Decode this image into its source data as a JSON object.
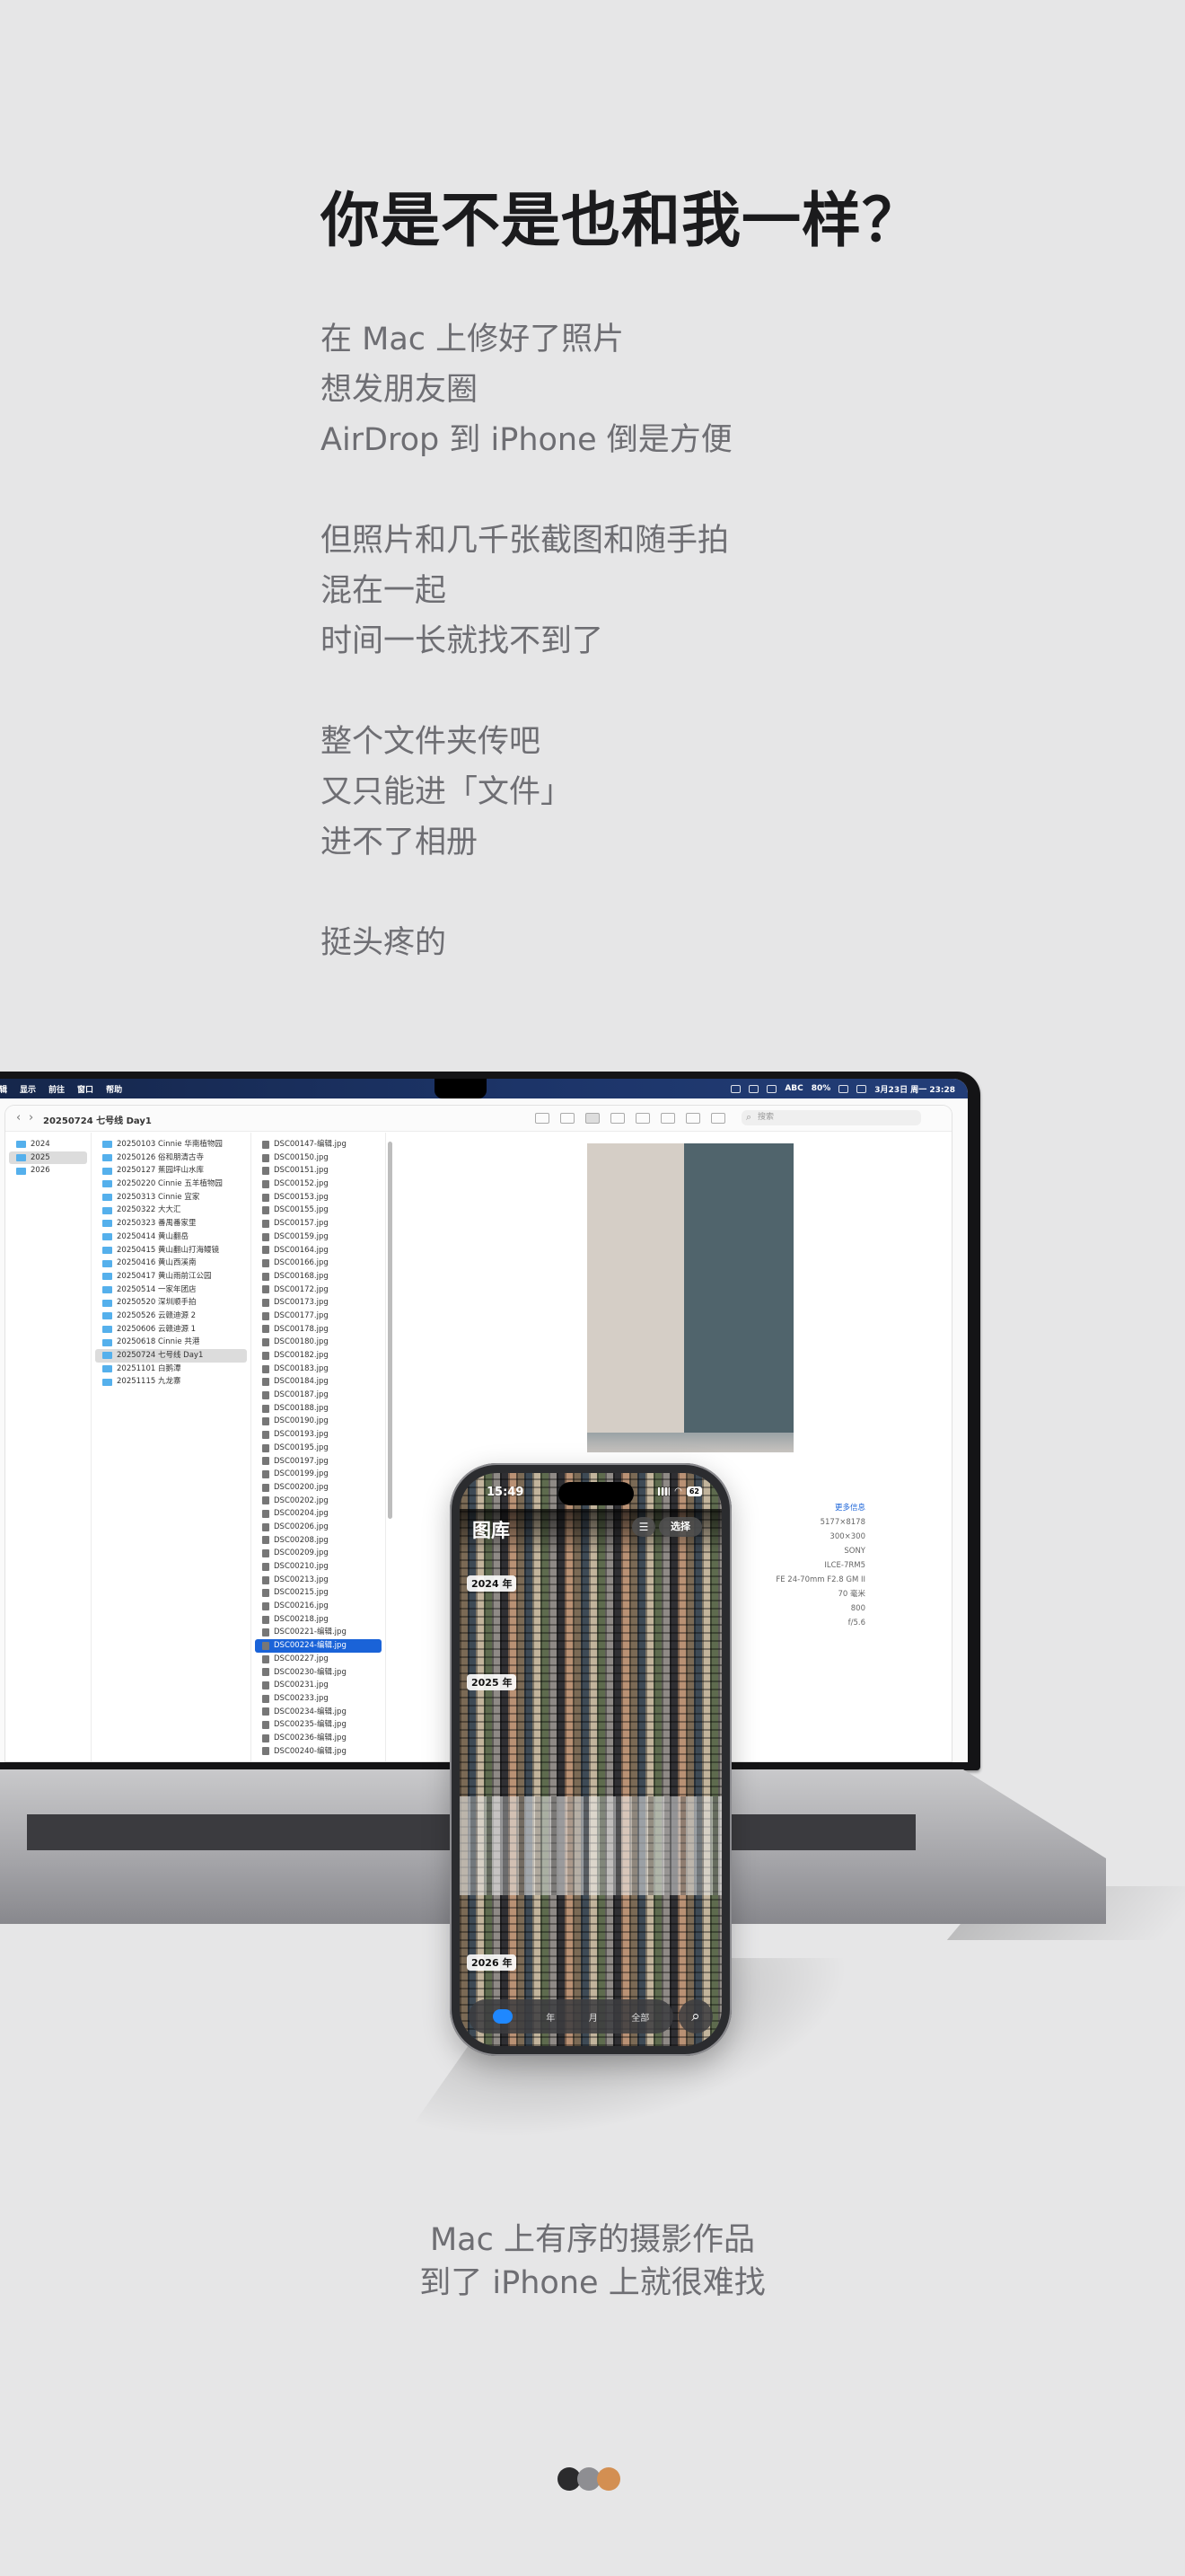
{
  "headline": "你是不是也和我一样？",
  "story": {
    "paragraphs": [
      [
        "在 Mac 上修好了照片",
        "想发朋友圈",
        "AirDrop 到 iPhone 倒是方便"
      ],
      [
        "但照片和几千张截图和随手拍",
        "混在一起",
        "时间一长就找不到了"
      ],
      [
        "整个文件夹传吧",
        "又只能进「文件」",
        "进不了相册"
      ],
      [
        "挺头疼的"
      ]
    ]
  },
  "mac": {
    "menubar": {
      "items": [
        "编辑",
        "显示",
        "前往",
        "窗口",
        "帮助"
      ],
      "clock": "3月23日 周一 23:28",
      "battery": "80%",
      "input_method": "ABC"
    },
    "finder": {
      "title": "20250724 七号线 Day1",
      "search_placeholder": "搜索",
      "years": [
        "2024",
        "2025",
        "2026"
      ],
      "selected_year": "2025",
      "folders": [
        "20250103 Cinnie 华南植物园",
        "20250126 俗和朋清古寺",
        "20250127 蕉园坪山水库",
        "20250220 Cinnie 五羊植物园",
        "20250313 Cinnie 宜家",
        "20250322 大大汇",
        "20250323 番禺番家里",
        "20250414 黄山翻岳",
        "20250415 黄山翻山打海鳗镜",
        "20250416 黄山西溪南",
        "20250417 黄山雨前江公园",
        "20250514 一家年团店",
        "20250520 深圳顺手拍",
        "20250526 云赣迪源 2",
        "20250606 云赣迪源 1",
        "20250618 Cinnie 共港",
        "20250724 七号线 Day1",
        "20251101 白鹅潭",
        "20251115 九龙寨"
      ],
      "selected_folder": "20250724 七号线 Day1",
      "files": [
        "DSC00147-编辑.jpg",
        "DSC00150.jpg",
        "DSC00151.jpg",
        "DSC00152.jpg",
        "DSC00153.jpg",
        "DSC00155.jpg",
        "DSC00157.jpg",
        "DSC00159.jpg",
        "DSC00164.jpg",
        "DSC00166.jpg",
        "DSC00168.jpg",
        "DSC00172.jpg",
        "DSC00173.jpg",
        "DSC00177.jpg",
        "DSC00178.jpg",
        "DSC00180.jpg",
        "DSC00182.jpg",
        "DSC00183.jpg",
        "DSC00184.jpg",
        "DSC00187.jpg",
        "DSC00188.jpg",
        "DSC00190.jpg",
        "DSC00193.jpg",
        "DSC00195.jpg",
        "DSC00197.jpg",
        "DSC00199.jpg",
        "DSC00200.jpg",
        "DSC00202.jpg",
        "DSC00204.jpg",
        "DSC00206.jpg",
        "DSC00208.jpg",
        "DSC00209.jpg",
        "DSC00210.jpg",
        "DSC00213.jpg",
        "DSC00215.jpg",
        "DSC00216.jpg",
        "DSC00218.jpg",
        "DSC00221-编辑.jpg",
        "DSC00224-编辑.jpg",
        "DSC00227.jpg",
        "DSC00230-编辑.jpg",
        "DSC00231.jpg",
        "DSC00233.jpg",
        "DSC00234-编辑.jpg",
        "DSC00235-编辑.jpg",
        "DSC00236-编辑.jpg",
        "DSC00240-编辑.jpg"
      ],
      "selected_file": "DSC00224-编辑.jpg",
      "metadata": {
        "more_link": "更多信息",
        "values": [
          "5177×8178",
          "300×300",
          "SONY",
          "ILCE-7RM5",
          "FE 24-70mm F2.8 GM II",
          "70 毫米",
          "800",
          "f/5.6"
        ]
      }
    }
  },
  "phone": {
    "time": "15:49",
    "battery": "62",
    "title": "图库",
    "select_label": "选择",
    "year_tags": [
      "2024 年",
      "2025 年",
      "2026 年"
    ],
    "tabs": [
      "年",
      "月",
      "全部"
    ]
  },
  "caption": [
    "Mac 上有序的摄影作品",
    "到了 iPhone 上就很难找"
  ],
  "dots": [
    "#2b2b2d",
    "#8e8e92",
    "#d38f52"
  ]
}
